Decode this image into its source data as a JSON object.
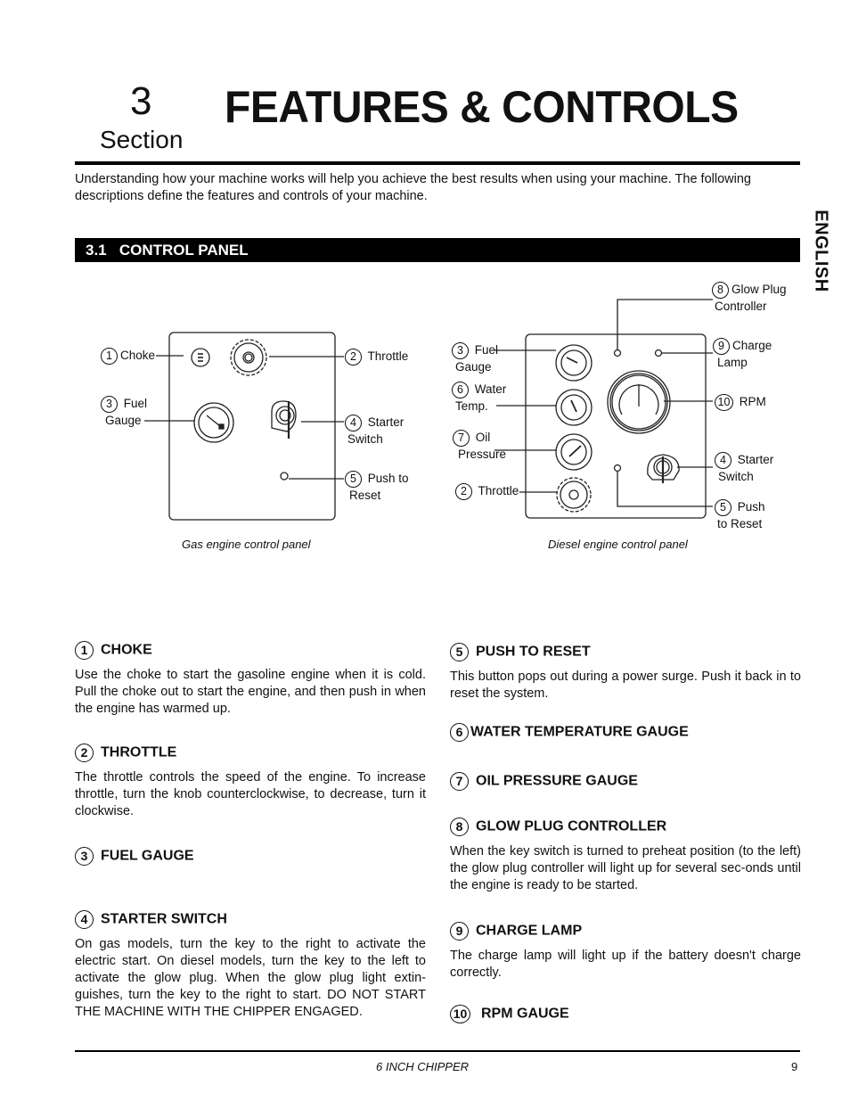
{
  "header": {
    "section_number": "3",
    "section_word": "Section",
    "title": "FEATURES & CONTROLS"
  },
  "intro": "Understanding how your machine works will help you achieve the best results when using your machine.  The following descriptions define the features and controls of your machine.",
  "side_tab": "ENGLISH",
  "subsection": {
    "number": "3.1",
    "title": "CONTROL PANEL"
  },
  "gas_panel": {
    "caption": "Gas engine control panel",
    "callouts": [
      {
        "num": "1",
        "line1": "Choke",
        "line2": ""
      },
      {
        "num": "2",
        "line1": "Throttle",
        "line2": ""
      },
      {
        "num": "3",
        "line1": "Fuel",
        "line2": "Gauge"
      },
      {
        "num": "4",
        "line1": "Starter",
        "line2": "Switch"
      },
      {
        "num": "5",
        "line1": "Push to",
        "line2": "Reset"
      }
    ]
  },
  "diesel_panel": {
    "caption": "Diesel engine control panel",
    "callouts": [
      {
        "num": "8",
        "line1": "Glow Plug",
        "line2": "Controller"
      },
      {
        "num": "3",
        "line1": "Fuel",
        "line2": "Gauge"
      },
      {
        "num": "9",
        "line1": "Charge",
        "line2": "Lamp"
      },
      {
        "num": "6",
        "line1": "Water",
        "line2": "Temp."
      },
      {
        "num": "10",
        "line1": "RPM",
        "line2": ""
      },
      {
        "num": "7",
        "line1": "Oil",
        "line2": "Pressure"
      },
      {
        "num": "4",
        "line1": "Starter",
        "line2": "Switch"
      },
      {
        "num": "2",
        "line1": "Throttle",
        "line2": ""
      },
      {
        "num": "5",
        "line1": "Push",
        "line2": "to Reset"
      }
    ]
  },
  "items_left": [
    {
      "num": "1",
      "title": "CHOKE",
      "body": "Use the choke to start the gasoline engine when it is cold. Pull the choke out to start the engine, and then push in when the engine has warmed up."
    },
    {
      "num": "2",
      "title": "THROTTLE",
      "body": "The throttle controls the speed of the engine. To increase throttle, turn the knob counterclockwise, to decrease, turn it clockwise."
    },
    {
      "num": "3",
      "title": "FUEL GAUGE",
      "body": ""
    },
    {
      "num": "4",
      "title": "STARTER SWITCH",
      "body": "On gas models, turn the key to the right to activate the electric start. On diesel models, turn the key to the left to activate the glow plug. When the glow plug light extin-guishes, turn the key to the right to start. DO NOT START THE MACHINE WITH THE CHIPPER ENGAGED."
    }
  ],
  "items_right": [
    {
      "num": "5",
      "title": "PUSH TO RESET",
      "body": "This button pops out during a power surge. Push it back in to reset the system."
    },
    {
      "num": "6",
      "title": "WATER TEMPERATURE GAUGE",
      "body": ""
    },
    {
      "num": "7",
      "title": "OIL PRESSURE GAUGE",
      "body": ""
    },
    {
      "num": "8",
      "title": "GLOW PLUG CONTROLLER",
      "body": "When the key switch is turned to preheat position (to the left) the glow plug controller will light up for several sec-onds until the engine is ready to be started."
    },
    {
      "num": "9",
      "title": "CHARGE LAMP",
      "body": "The charge lamp will light up if the battery doesn't charge correctly."
    },
    {
      "num": "10",
      "title": "RPM GAUGE",
      "body": ""
    }
  ],
  "footer": {
    "product": "6 INCH CHIPPER",
    "page": "9"
  }
}
